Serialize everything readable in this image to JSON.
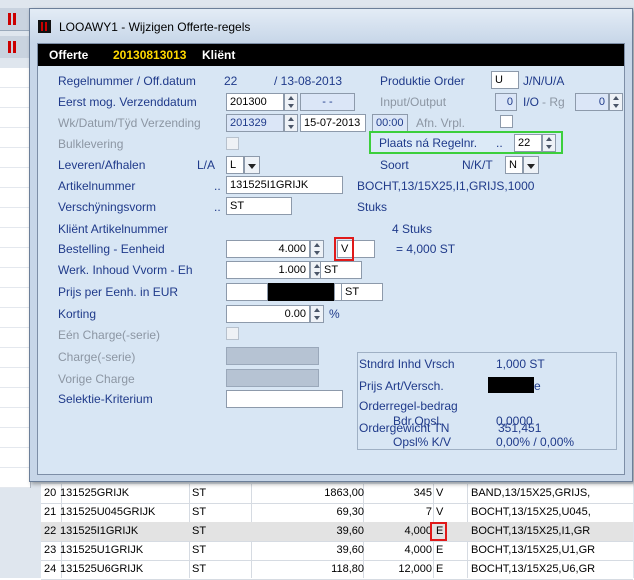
{
  "dialog": {
    "title": "LOOAWY1 - Wijzigen Offerte-regels",
    "header": {
      "offerte_label": "Offerte",
      "offerte_number": "20130813013",
      "klient_label": "Kliënt"
    }
  },
  "form": {
    "regelnummer": {
      "label": "Regelnummer / Off.datum",
      "value": "22",
      "date": "/ 13-08-2013"
    },
    "productie_order": {
      "label": "Produktie Order",
      "value": "U",
      "options": "J/N/U/A"
    },
    "eerst_mog": {
      "label": "Eerst mog. Verzenddatum",
      "value": "201300",
      "extra": "- -"
    },
    "input_output": {
      "label": "Input/Output",
      "value": "0",
      "io_label": "I/O",
      "rg_label": "- Rg",
      "rg_value": "0"
    },
    "wk_datum": {
      "label": "Wk/Datum/Tÿd Verzending",
      "week": "201329",
      "date": "15-07-2013",
      "time": "00:00"
    },
    "afn_vrpl": {
      "label": "Afn. Vrpl."
    },
    "bulklevering": {
      "label": "Bulklevering"
    },
    "plaats": {
      "label": "Plaats ná Regelnr.",
      "dots": "..",
      "value": "22"
    },
    "leveren": {
      "label": "Leveren/Afhalen",
      "options": "L/A",
      "value": "L"
    },
    "soort": {
      "label": "Soort",
      "options": "N/K/T",
      "value": "N"
    },
    "artikelnummer": {
      "label": "Artikelnummer",
      "dots": "..",
      "value": "131525I1GRIJK",
      "description": "BOCHT,13/15X25,I1,GRIJS,1000"
    },
    "verschijningsvorm": {
      "label": "Verschÿningsvorm",
      "dots": "..",
      "value": "ST",
      "unit_text": "Stuks"
    },
    "klient_artikel": {
      "label": "Kliënt Artikelnummer",
      "info": "4 Stuks"
    },
    "bestelling": {
      "label": "Bestelling - Eenheid",
      "value": "4.000",
      "unit": "V",
      "result": "= 4,000 ST"
    },
    "werk_inhoud": {
      "label": "Werk. Inhoud Vvorm - Eh",
      "value": "1.000",
      "unit": "ST"
    },
    "prijs": {
      "label": "Prijs per Eenh. in EUR",
      "unit": "ST"
    },
    "korting": {
      "label": "Korting",
      "value": "0.00",
      "unit": "%"
    },
    "een_charge": {
      "label": "Eén Charge(-serie)"
    },
    "charge": {
      "label": "Charge(-serie)"
    },
    "vorige_charge": {
      "label": "Vorige Charge"
    },
    "selektie": {
      "label": "Selektie-Kriterium"
    },
    "panel": {
      "stndrd_label": "Stndrd Inhd Vrsch",
      "stndrd_value": "1,000 ST",
      "prijs_label": "Prijs Art/Versch.",
      "prijs_suffix": "e",
      "orderregel_label": "Orderregel-bedrag",
      "gewicht_label": "Ordergewicht TN",
      "gewicht_value": "351,451"
    },
    "bdr_opsl": {
      "label": "Bdr.Opsl.",
      "value": "0,0000"
    },
    "opsl_kv": {
      "label": "Opsl% K/V",
      "value": "0,00% / 0,00%"
    }
  },
  "grid": {
    "rows": [
      {
        "nr": "20",
        "artikel": "131525GRIJK",
        "eh": "ST",
        "prijs": "1863,00",
        "aantal": "345",
        "v": "V",
        "omschr": "BAND,13/15X25,GRIJS,"
      },
      {
        "nr": "21",
        "artikel": "131525U045GRIJK",
        "eh": "ST",
        "prijs": "69,30",
        "aantal": "7",
        "v": "V",
        "omschr": "BOCHT,13/15X25,U045,"
      },
      {
        "nr": "22",
        "artikel": "131525I1GRIJK",
        "eh": "ST",
        "prijs": "39,60",
        "aantal": "4,000",
        "v": "E",
        "omschr": "BOCHT,13/15X25,I1,GR"
      },
      {
        "nr": "23",
        "artikel": "131525U1GRIJK",
        "eh": "ST",
        "prijs": "39,60",
        "aantal": "4,000",
        "v": "E",
        "omschr": "BOCHT,13/15X25,U1,GR"
      },
      {
        "nr": "24",
        "artikel": "131525U6GRIJK",
        "eh": "ST",
        "prijs": "118,80",
        "aantal": "12,000",
        "v": "E",
        "omschr": "BOCHT,13/15X25,U6,GR"
      }
    ]
  }
}
